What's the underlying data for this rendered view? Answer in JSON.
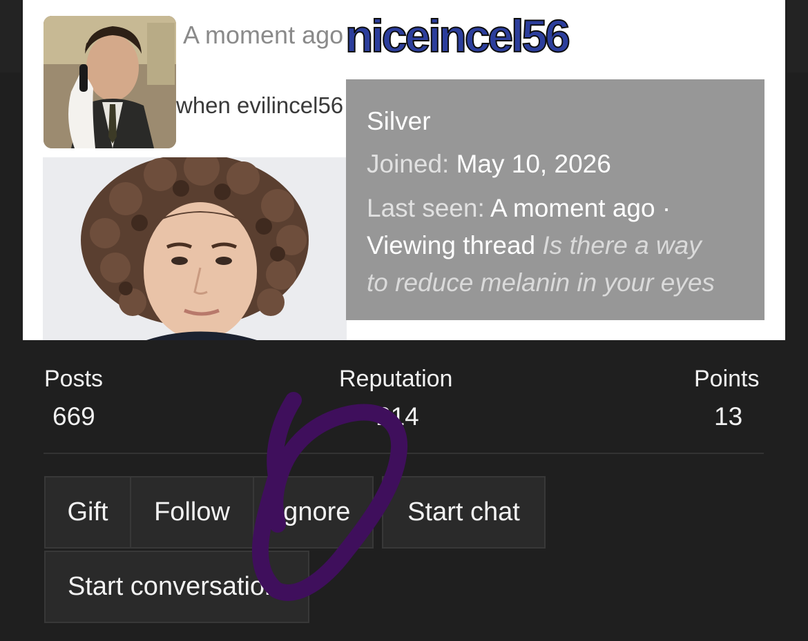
{
  "post": {
    "time": "A moment ago",
    "text": "when evilincel56 shows up"
  },
  "profile": {
    "username": "niceincel56",
    "rank": "Silver",
    "joined_label": "Joined:",
    "joined_value": "May 10, 2026",
    "last_seen_label": "Last seen:",
    "last_seen_value": "A moment ago ·",
    "activity_label": "Viewing thread",
    "thread_title_line1": "Is there a way",
    "thread_title_line2": "to reduce melanin in your eyes"
  },
  "stats": {
    "posts_label": "Posts",
    "posts_value": "669",
    "reputation_label": "Reputation",
    "reputation_value": "214",
    "points_label": "Points",
    "points_value": "13"
  },
  "actions": {
    "gift": "Gift",
    "follow": "Follow",
    "ignore": "Ignore",
    "start_chat": "Start chat",
    "start_conversation": "Start conversation"
  },
  "colors": {
    "username_fill": "#2c3e9c",
    "scribble": "#3f0f5c",
    "overlay": "#979797"
  }
}
